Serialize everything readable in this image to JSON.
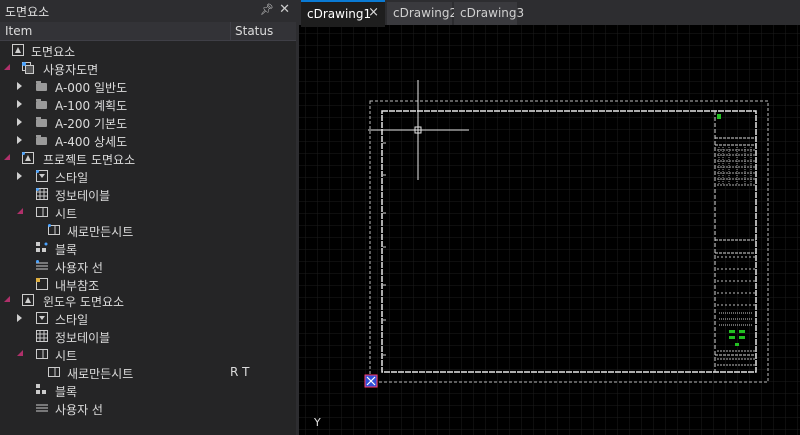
{
  "panel": {
    "title": "도면요소",
    "pin_icon": "pin-icon",
    "close_icon": "close-icon",
    "columns": {
      "item": "Item",
      "status": "Status"
    },
    "rows": {
      "root": "도면요소",
      "user": "사용자도면",
      "a000": "A-000 일반도",
      "a100": "A-100 계획도",
      "a200": "A-200 기본도",
      "a400": "A-400 상세도",
      "proj": "프로젝트 도면요소",
      "proj_style": "스타일",
      "proj_table": "정보테이블",
      "proj_sheet": "시트",
      "proj_newsheet": "새로만든시트",
      "proj_block": "블록",
      "proj_user_line": "사용자 선",
      "proj_xref": "내부참조",
      "win": "윈도우 도면요소",
      "win_style": "스타일",
      "win_table": "정보테이블",
      "win_sheet": "시트",
      "win_newsheet": "새로만든시트",
      "win_newsheet_status": "R T",
      "win_block": "블록",
      "win_user_line": "사용자 선"
    }
  },
  "tabs": [
    {
      "label": "cDrawing1",
      "active": true
    },
    {
      "label": "cDrawing2",
      "active": false
    },
    {
      "label": "cDrawing3",
      "active": false
    }
  ],
  "tab_close": "×",
  "tab_add": "+",
  "canvas": {
    "ucs_axis_label": "Y",
    "background": "#000000",
    "grid_color": "#1c1c1c",
    "accent": "#0a7ad3",
    "expand_color": "#b0306a"
  }
}
